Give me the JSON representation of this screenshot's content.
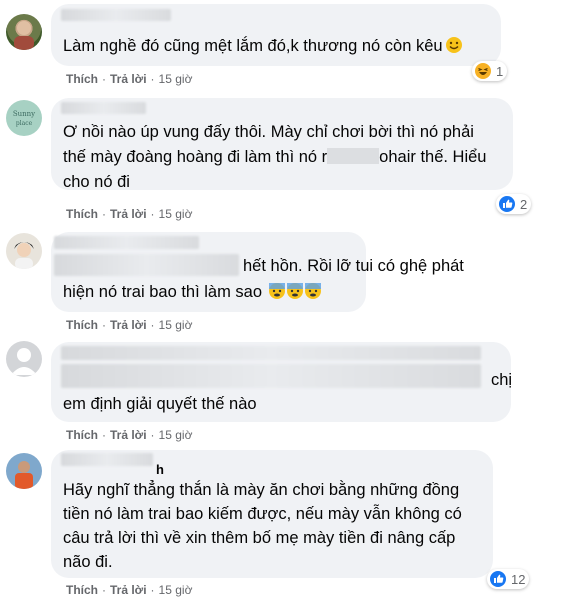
{
  "comments": [
    {
      "name": "",
      "text": "Làm nghề đó cũng mệt lắm đó,k thương nó còn kêu",
      "reaction_count": "1",
      "actions": {
        "like": "Thích",
        "reply": "Trả lời",
        "time": "15 giờ"
      }
    },
    {
      "name": "",
      "text_line1": "Ơ nồi nào úp vung đấy thôi. Mày chỉ chơi bời thì nó phải",
      "text_line2a": "thế mày đoàng hoàng đi làm thì nó r",
      "text_line2b": "ohair thế. Hiểu",
      "text_line3": "cho nó đi",
      "reaction_count": "2",
      "actions": {
        "like": "Thích",
        "reply": "Trả lời",
        "time": "15 giờ"
      }
    },
    {
      "text_line1": "hết hồn. Rồi lỡ tui có ghệ phát",
      "text_line2": "hiện nó trai bao thì làm sao",
      "actions": {
        "like": "Thích",
        "reply": "Trả lời",
        "time": "15 giờ"
      }
    },
    {
      "text_line1": "chị",
      "text_line2": "em định giải quyết thế nào",
      "actions": {
        "like": "Thích",
        "reply": "Trả lời",
        "time": "15 giờ"
      }
    },
    {
      "name": "h",
      "text_line1": "Hãy nghĩ thẳng thắn là mày ăn chơi bằng những đồng",
      "text_line2": "tiền nó làm trai bao kiếm được, nếu mày vẫn không có",
      "text_line3": "câu trả lời thì về xin thêm bố mẹ mày tiền đi nâng cấp",
      "text_line4": "não đi.",
      "reaction_count": "12",
      "actions": {
        "like": "Thích",
        "reply": "Trả lời",
        "time": "15 giờ"
      }
    }
  ],
  "colors": {
    "bubble": "#f0f2f5",
    "meta": "#65676b",
    "like_blue": "#1877f2",
    "haha_yellow": "#f7b125"
  },
  "icons": [
    "smile-emoji-icon",
    "haha-reaction-icon",
    "like-reaction-icon",
    "anxious-face-emoji-icon"
  ]
}
